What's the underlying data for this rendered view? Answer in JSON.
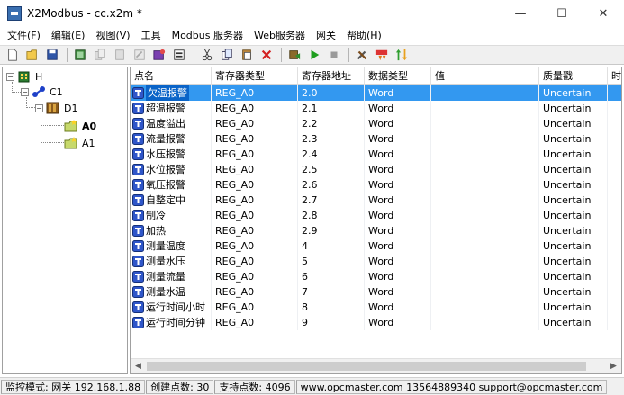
{
  "window": {
    "title": "X2Modbus - cc.x2m *",
    "minimize": "—",
    "maximize": "☐",
    "close": "✕"
  },
  "menu": [
    {
      "label": "文件(F)"
    },
    {
      "label": "编辑(E)"
    },
    {
      "label": "视图(V)"
    },
    {
      "label": "工具"
    },
    {
      "label": "Modbus 服务器"
    },
    {
      "label": "Web服务器"
    },
    {
      "label": "网关"
    },
    {
      "label": "帮助(H)"
    }
  ],
  "toolbar": {
    "icons": [
      "new-icon",
      "open-icon",
      "save-icon",
      "sep",
      "view-icon",
      "copy-disabled-icon",
      "paste-disabled-icon",
      "edit-disabled-icon",
      "add-device-icon",
      "properties-icon",
      "sep",
      "cut-icon",
      "copy-icon",
      "paste-icon",
      "delete-icon",
      "sep",
      "driver-icon",
      "run-icon",
      "stop-icon",
      "sep",
      "tools-icon",
      "log-icon",
      "exchange-icon"
    ]
  },
  "tree": {
    "root": "H",
    "channel": "C1",
    "device": "D1",
    "groups": [
      {
        "label": "A0",
        "selected": true
      },
      {
        "label": "A1",
        "selected": false
      }
    ]
  },
  "list": {
    "columns": [
      "点名",
      "寄存器类型",
      "寄存器地址",
      "数据类型",
      "值",
      "质量戳",
      "时"
    ],
    "rows": [
      {
        "name": "欠温报警",
        "reg_type": "REG_A0",
        "reg_addr": "2.0",
        "data_type": "Word",
        "value": "",
        "quality": "Uncertain"
      },
      {
        "name": "超温报警",
        "reg_type": "REG_A0",
        "reg_addr": "2.1",
        "data_type": "Word",
        "value": "",
        "quality": "Uncertain"
      },
      {
        "name": "温度溢出",
        "reg_type": "REG_A0",
        "reg_addr": "2.2",
        "data_type": "Word",
        "value": "",
        "quality": "Uncertain"
      },
      {
        "name": "流量报警",
        "reg_type": "REG_A0",
        "reg_addr": "2.3",
        "data_type": "Word",
        "value": "",
        "quality": "Uncertain"
      },
      {
        "name": "水压报警",
        "reg_type": "REG_A0",
        "reg_addr": "2.4",
        "data_type": "Word",
        "value": "",
        "quality": "Uncertain"
      },
      {
        "name": "水位报警",
        "reg_type": "REG_A0",
        "reg_addr": "2.5",
        "data_type": "Word",
        "value": "",
        "quality": "Uncertain"
      },
      {
        "name": "氧压报警",
        "reg_type": "REG_A0",
        "reg_addr": "2.6",
        "data_type": "Word",
        "value": "",
        "quality": "Uncertain"
      },
      {
        "name": "自整定中",
        "reg_type": "REG_A0",
        "reg_addr": "2.7",
        "data_type": "Word",
        "value": "",
        "quality": "Uncertain"
      },
      {
        "name": "制冷",
        "reg_type": "REG_A0",
        "reg_addr": "2.8",
        "data_type": "Word",
        "value": "",
        "quality": "Uncertain"
      },
      {
        "name": "加热",
        "reg_type": "REG_A0",
        "reg_addr": "2.9",
        "data_type": "Word",
        "value": "",
        "quality": "Uncertain"
      },
      {
        "name": "测量温度",
        "reg_type": "REG_A0",
        "reg_addr": "4",
        "data_type": "Word",
        "value": "",
        "quality": "Uncertain"
      },
      {
        "name": "测量水压",
        "reg_type": "REG_A0",
        "reg_addr": "5",
        "data_type": "Word",
        "value": "",
        "quality": "Uncertain"
      },
      {
        "name": "测量流量",
        "reg_type": "REG_A0",
        "reg_addr": "6",
        "data_type": "Word",
        "value": "",
        "quality": "Uncertain"
      },
      {
        "name": "测量水温",
        "reg_type": "REG_A0",
        "reg_addr": "7",
        "data_type": "Word",
        "value": "",
        "quality": "Uncertain"
      },
      {
        "name": "运行时间小时",
        "reg_type": "REG_A0",
        "reg_addr": "8",
        "data_type": "Word",
        "value": "",
        "quality": "Uncertain"
      },
      {
        "name": "运行时间分钟",
        "reg_type": "REG_A0",
        "reg_addr": "9",
        "data_type": "Word",
        "value": "",
        "quality": "Uncertain"
      }
    ],
    "selected_row": 0
  },
  "status": {
    "mode": "监控模式: 网关 192.168.1.88",
    "points": "创建点数: 30",
    "support": "支持点数: 4096",
    "contact": "www.opcmaster.com 13564889340 support@opcmaster.com"
  },
  "colors": {
    "selection": "#3398f0",
    "selection_text_bg": "#0a64c8",
    "tag_icon": "#2f56c9"
  }
}
